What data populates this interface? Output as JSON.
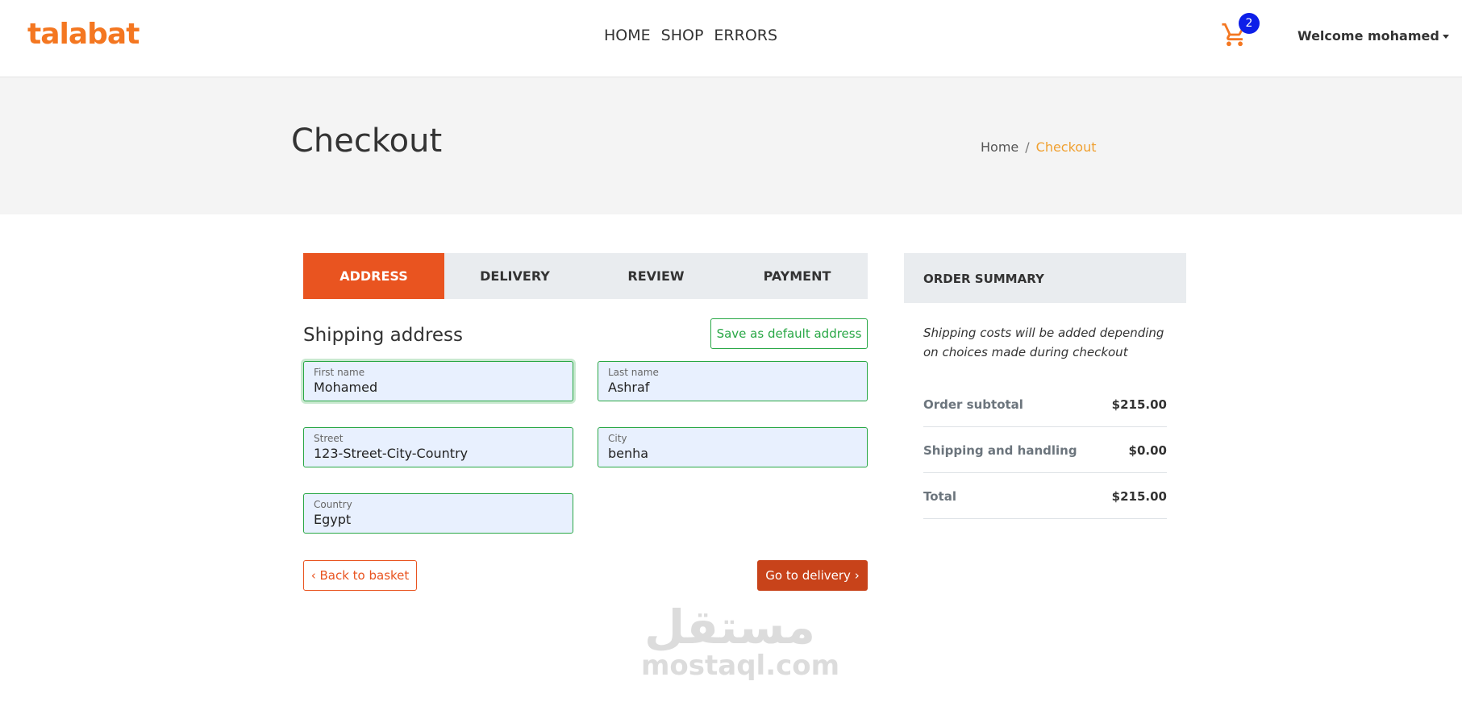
{
  "brand": {
    "name": "talabat",
    "color": "#f47721"
  },
  "nav": {
    "items": [
      "HOME",
      "SHOP",
      "ERRORS"
    ]
  },
  "cart": {
    "icon": "cart-icon",
    "count": "2"
  },
  "user": {
    "greeting": "Welcome mohamed"
  },
  "page": {
    "title": "Checkout"
  },
  "breadcrumb": {
    "home": "Home",
    "separator": "/",
    "current": "Checkout"
  },
  "steps": {
    "items": [
      "ADDRESS",
      "DELIVERY",
      "REVIEW",
      "PAYMENT"
    ],
    "active": "ADDRESS"
  },
  "shipping": {
    "title": "Shipping address",
    "save_default_label": "Save as default address",
    "fields": {
      "first_name": {
        "label": "First name",
        "value": "Mohamed"
      },
      "last_name": {
        "label": "Last name",
        "value": "Ashraf"
      },
      "street": {
        "label": "Street",
        "value": "123-Street-City-Country"
      },
      "city": {
        "label": "City",
        "value": "benha"
      },
      "country": {
        "label": "Country",
        "value": "Egypt"
      }
    },
    "back_label": "‹ Back to basket",
    "next_label": "Go to delivery ›"
  },
  "summary": {
    "title": "ORDER SUMMARY",
    "note": "Shipping costs will be added depending on choices made during checkout",
    "rows": [
      {
        "label": "Order subtotal",
        "value": "$215.00"
      },
      {
        "label": "Shipping and handling",
        "value": "$0.00"
      },
      {
        "label": "Total",
        "value": "$215.00"
      }
    ]
  },
  "watermark": {
    "arabic": "مستقل",
    "latin": "mostaql.com"
  },
  "colors": {
    "accent": "#e95420",
    "success": "#28a745",
    "badge": "#0d1fe8"
  }
}
